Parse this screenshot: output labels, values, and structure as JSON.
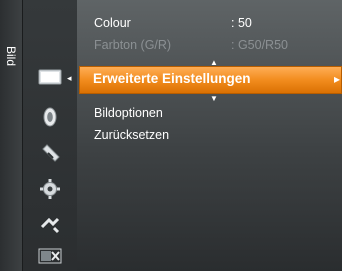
{
  "side_tab": {
    "label": "Bild"
  },
  "menu": {
    "items": [
      {
        "label": "Colour",
        "value": ": 50"
      },
      {
        "label": "Farbton (G/R)",
        "value": ": G50/R50"
      },
      {
        "label": "Erweiterte Einstellungen",
        "value": ""
      },
      {
        "label": "Bildoptionen",
        "value": ""
      },
      {
        "label": "Zurücksetzen",
        "value": ""
      }
    ],
    "submenu_arrow": "▸",
    "back_arrow": "◂"
  },
  "icons": [
    "picture-icon",
    "sound-icon",
    "channel-icon",
    "settings-icon",
    "input-icon",
    "application-icon"
  ],
  "colors": {
    "highlight": "#f28c1e",
    "text": "#ffffff",
    "dim_text": "#8b9093"
  }
}
